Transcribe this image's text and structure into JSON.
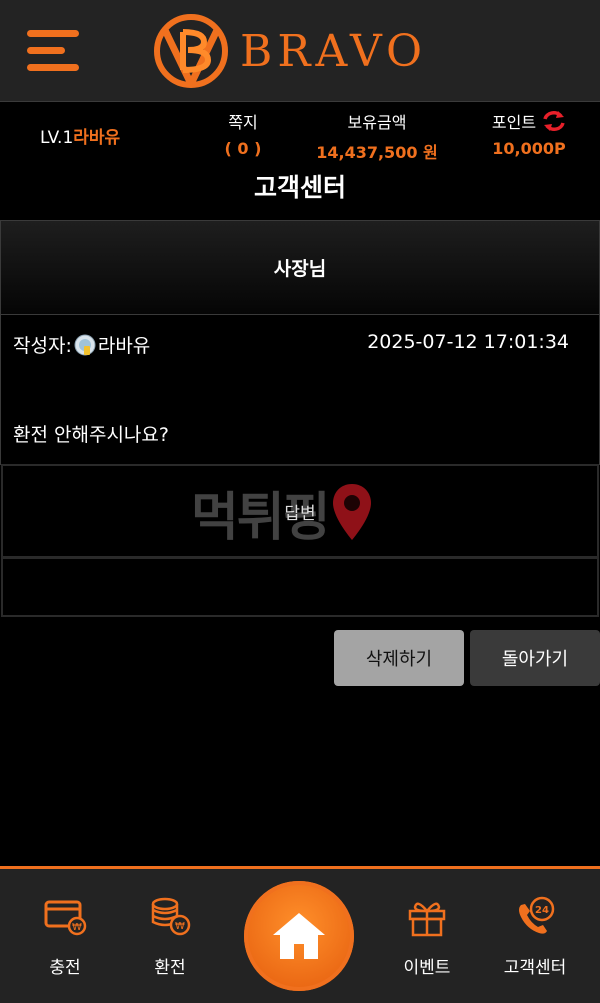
{
  "header": {
    "logo_text": "BRAVO"
  },
  "user": {
    "level": "LV.1",
    "nickname": "라바유"
  },
  "info": {
    "memo_label": "쪽지",
    "memo_value": "( 0 )",
    "money_label": "보유금액",
    "money_value": "14,437,500 원",
    "point_label": "포인트",
    "point_value": "10,000P"
  },
  "page": {
    "title": "고객센터"
  },
  "post": {
    "subject": "사장님",
    "author_prefix": "작성자:",
    "author": "라바유",
    "date": "2025-07-12 17:01:34",
    "content": "환전 안해주시나요?",
    "answer_label": "답변",
    "watermark": "먹튀핑"
  },
  "buttons": {
    "delete": "삭제하기",
    "back": "돌아가기"
  },
  "nav": {
    "charge": "충전",
    "exchange": "환전",
    "event": "이벤트",
    "support": "고객센터"
  },
  "colors": {
    "accent": "#f0701e",
    "header_bg": "#232323",
    "page_bg": "#000000"
  }
}
